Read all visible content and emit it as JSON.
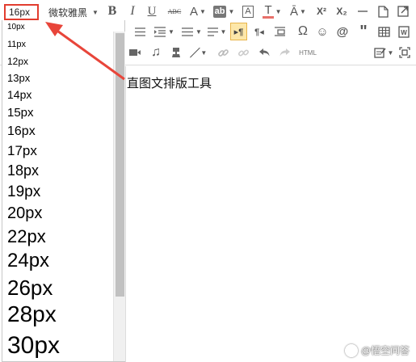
{
  "toolbar": {
    "font_size_value": "16px",
    "font_family_value": "微软雅黑",
    "bold_icon": "bold-icon",
    "italic_icon": "italic-icon",
    "underline_icon": "underline-icon",
    "strikethrough_label": "ABC",
    "font_color_label": "A",
    "highlight_label": "ab",
    "text_border_label": "A",
    "superscript_label": "X²",
    "subscript_label": "X₂",
    "html_label": "HTML",
    "highlight_color": "#e23d2f"
  },
  "font_size_dropdown": {
    "options": [
      "10px",
      "11px",
      "12px",
      "13px",
      "14px",
      "15px",
      "16px",
      "17px",
      "18px",
      "19px",
      "20px",
      "22px",
      "24px",
      "26px",
      "28px",
      "30px"
    ]
  },
  "editor": {
    "content": "直图文排版工具"
  },
  "watermark": {
    "text": "@悟空问答"
  }
}
